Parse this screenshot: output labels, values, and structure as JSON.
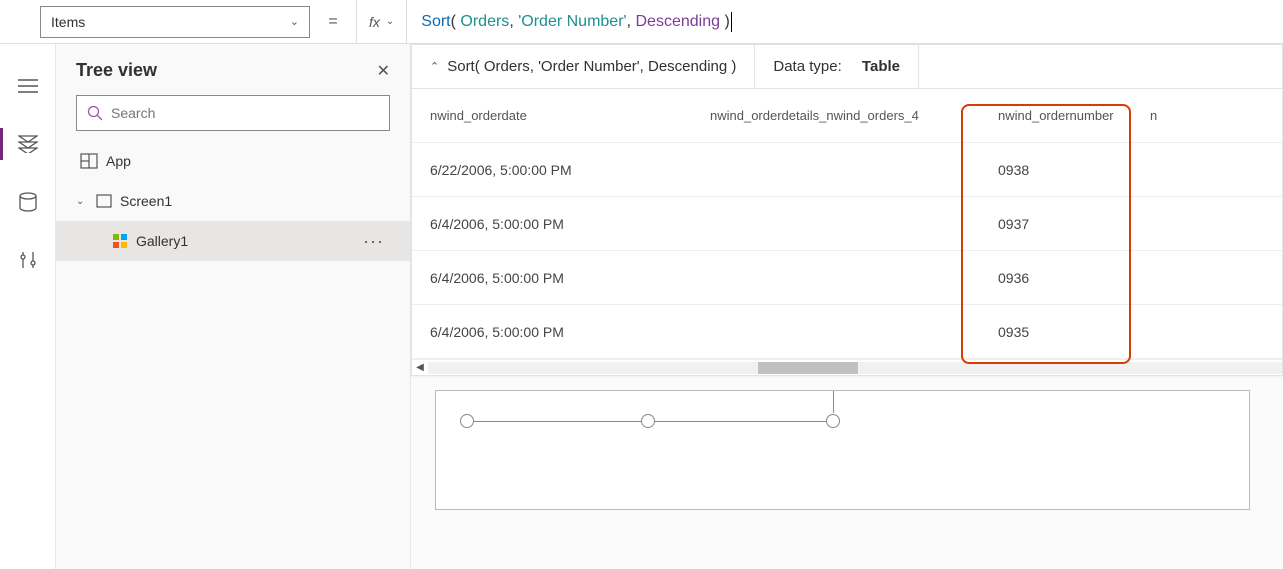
{
  "property_selector": {
    "value": "Items"
  },
  "formula": {
    "fx_label": "fx",
    "tokens": {
      "func": "Sort",
      "open": "(",
      "arg1": "Orders",
      "comma": ",",
      "arg2": "'Order Number'",
      "arg3": "Descending",
      "close": ")"
    }
  },
  "result": {
    "context_text": "Sort( Orders, 'Order Number', Descending )",
    "datatype_label": "Data type:",
    "datatype_value": "Table",
    "columns": {
      "c1": "nwind_orderdate",
      "c2": "nwind_orderdetails_nwind_orders_4",
      "c3": "nwind_ordernumber",
      "c4": "n"
    },
    "rows": [
      {
        "date": "6/22/2006, 5:00:00 PM",
        "details": "",
        "num": "0938"
      },
      {
        "date": "6/4/2006, 5:00:00 PM",
        "details": "",
        "num": "0937"
      },
      {
        "date": "6/4/2006, 5:00:00 PM",
        "details": "",
        "num": "0936"
      },
      {
        "date": "6/4/2006, 5:00:00 PM",
        "details": "",
        "num": "0935"
      }
    ]
  },
  "tree": {
    "title": "Tree view",
    "search_placeholder": "Search",
    "app_label": "App",
    "screen_label": "Screen1",
    "gallery_label": "Gallery1"
  }
}
